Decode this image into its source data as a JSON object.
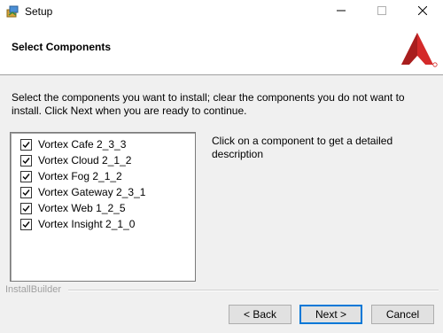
{
  "window": {
    "title": "Setup"
  },
  "header": {
    "title": "Select Components"
  },
  "instructions": "Select the components you want to install; clear the components you do not want to install. Click Next when you are ready to continue.",
  "components": [
    {
      "label": "Vortex Cafe 2_3_3",
      "checked": true
    },
    {
      "label": "Vortex Cloud 2_1_2",
      "checked": true
    },
    {
      "label": "Vortex Fog 2_1_2",
      "checked": true
    },
    {
      "label": "Vortex Gateway 2_3_1",
      "checked": true
    },
    {
      "label": "Vortex Web 1_2_5",
      "checked": true
    },
    {
      "label": "Vortex Insight 2_1_0",
      "checked": true
    }
  ],
  "description": "Click on a component to get a detailed description",
  "footer": {
    "brand": "InstallBuilder"
  },
  "buttons": {
    "back": "< Back",
    "next": "Next >",
    "cancel": "Cancel"
  },
  "colors": {
    "logo_red": "#d42a2a",
    "focus_blue": "#0078d7",
    "body_bg": "#f0f0f0"
  },
  "icons": {
    "app": "setup-app-icon",
    "minimize": "minimize-icon",
    "maximize": "maximize-icon",
    "close": "close-icon",
    "logo": "installbuilder-logo",
    "check": "checkmark-icon"
  }
}
